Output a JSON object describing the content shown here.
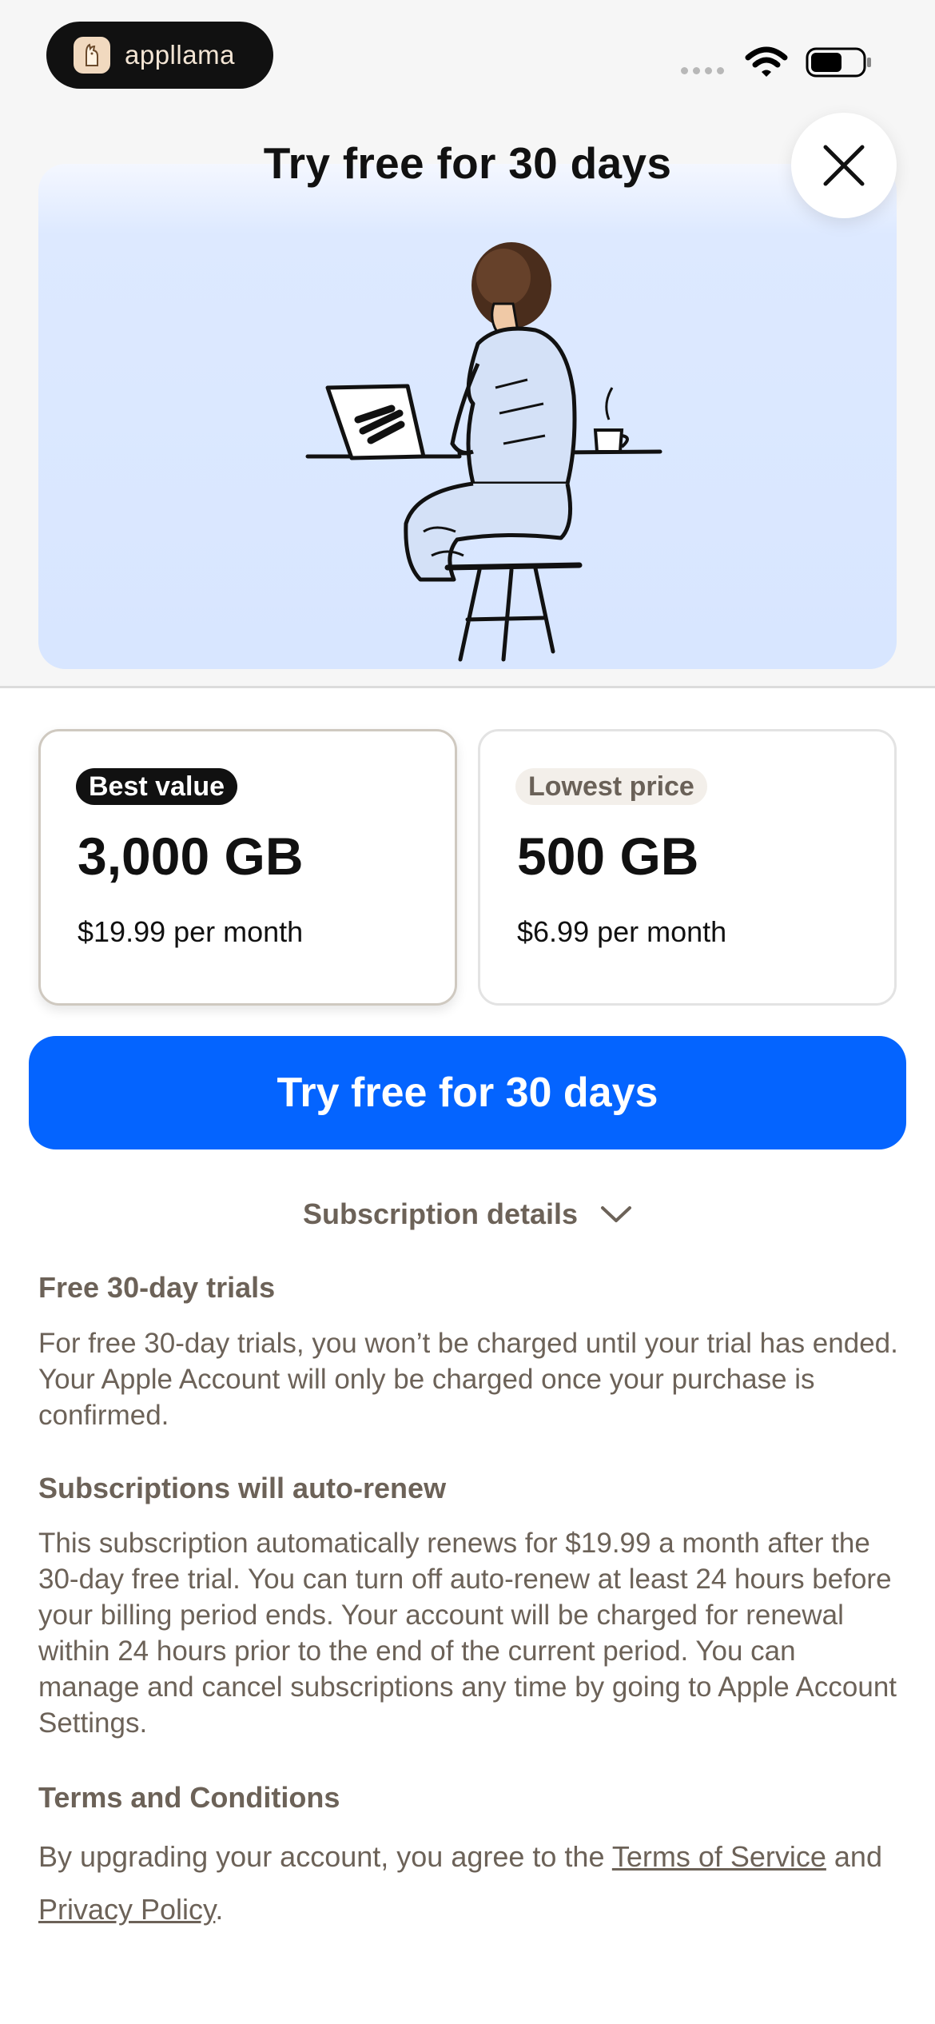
{
  "status_bar": {
    "app_name": "appllama",
    "app_logo_icon": "llama-icon",
    "signal_icon": "signal-dots-icon",
    "wifi_icon": "wifi-icon",
    "battery_icon": "battery-icon"
  },
  "hero": {
    "title": "Try free for 30 days",
    "illustration": "person-at-laptop-illustration"
  },
  "close_icon": "close-icon",
  "plans": [
    {
      "badge": "Best value",
      "size": "3,000 GB",
      "price": "$19.99 per month",
      "selected": true
    },
    {
      "badge": "Lowest price",
      "size": "500 GB",
      "price": "$6.99 per month",
      "selected": false
    }
  ],
  "cta": {
    "label": "Try free for 30 days",
    "color": "#0464ff"
  },
  "details": {
    "toggle_label": "Subscription details",
    "toggle_icon": "chevron-down-icon",
    "sections": [
      {
        "heading": "Free 30-day trials",
        "body": "For free 30-day trials, you won’t be charged until your trial has ended. Your Apple Account will only be charged once your purchase is confirmed."
      },
      {
        "heading": "Subscriptions will auto-renew",
        "body": "This subscription automatically renews for $19.99 a month after the 30-day free trial. You can turn off auto-renew at least 24 hours before your billing period ends. Your account will be charged for renewal within 24 hours prior to the end of the current period. You can manage and cancel subscriptions any time by going to Apple Account Settings."
      }
    ],
    "terms": {
      "heading": "Terms and Conditions",
      "prefix": "By upgrading your account, you agree to the ",
      "tos_link": "Terms of Service",
      "middle": " and ",
      "privacy_link": "Privacy Policy",
      "suffix": "."
    }
  },
  "colors": {
    "accent": "#0464ff",
    "muted_text": "#6c6258",
    "badge_dark": "#111111",
    "hero_bg": "#d8e6ff"
  }
}
